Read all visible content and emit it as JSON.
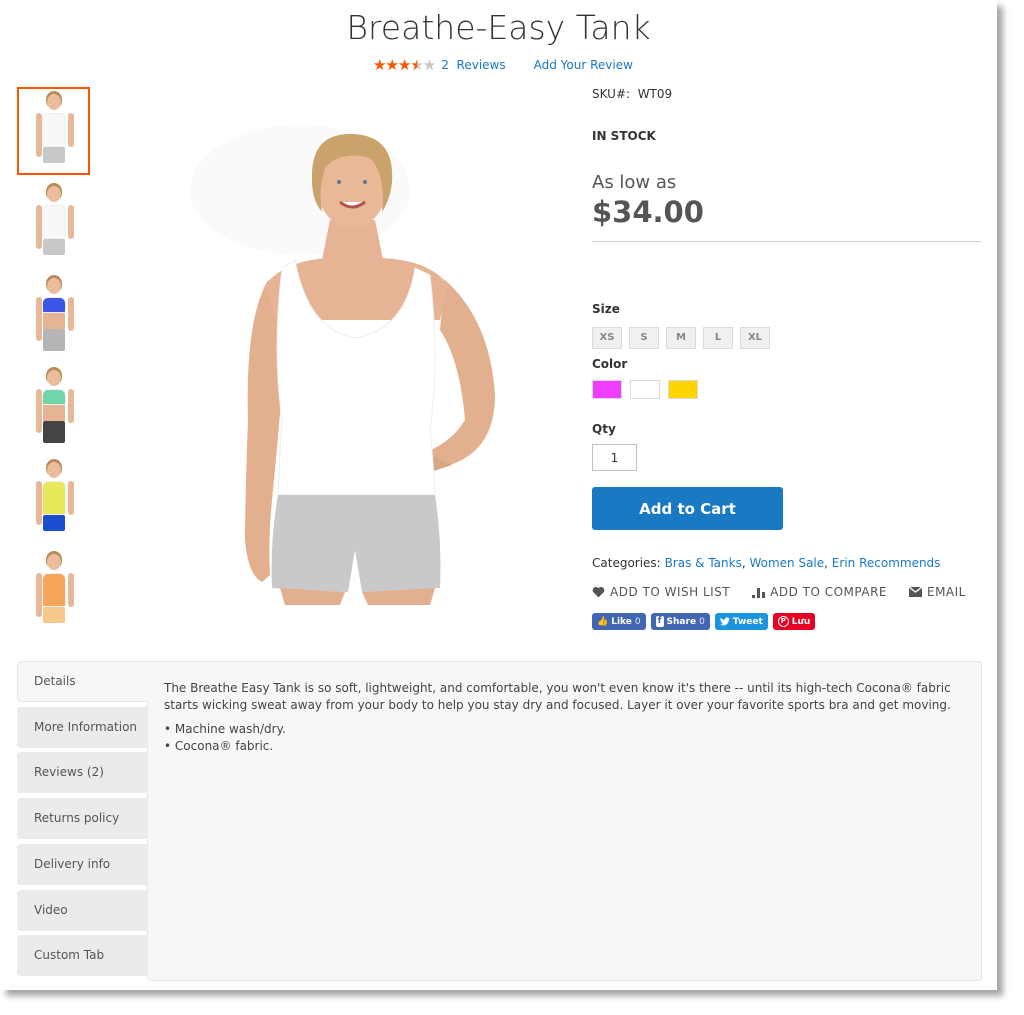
{
  "product": {
    "title": "Breathe-Easy Tank",
    "rating_percent": 70,
    "stars_glyph": "★★★★★",
    "reviews_count": "2",
    "reviews_label": "Reviews",
    "add_review_label": "Add Your Review",
    "sku_label": "SKU#:",
    "sku_value": "WT09",
    "stock_status": "IN STOCK",
    "price_prefix": "As low as",
    "price": "$34.00"
  },
  "gallery": {
    "active_index": 0,
    "thumbnails": [
      {
        "name": "white-tank-front",
        "top": "#f8f8f8",
        "bottom": "#c8c8c8"
      },
      {
        "name": "white-tank-back",
        "top": "#f8f8f8",
        "bottom": "#c8c8c8"
      },
      {
        "name": "blue-bra",
        "top": "#3b55e6",
        "bottom": "#b5b5b5"
      },
      {
        "name": "mint-bra",
        "top": "#6fd6ac",
        "bottom": "#444444"
      },
      {
        "name": "yellow-tee",
        "top": "#e8e85a",
        "bottom": "#1a4fd0"
      },
      {
        "name": "orange-tank",
        "top": "#f6a55a",
        "bottom": "#f6c98a"
      }
    ]
  },
  "options": {
    "size_label": "Size",
    "sizes": [
      "XS",
      "S",
      "M",
      "L",
      "XL"
    ],
    "color_label": "Color",
    "colors": [
      "#ef3dff",
      "#ffffff",
      "#ffd500"
    ],
    "qty_label": "Qty",
    "qty_value": "1"
  },
  "add_to_cart_label": "Add to Cart",
  "categories": {
    "label": "Categories:",
    "items": [
      "Bras & Tanks",
      "Women Sale",
      "Erin Recommends"
    ]
  },
  "actions": {
    "wishlist": "ADD TO WISH LIST",
    "compare": "ADD TO COMPARE",
    "email": "EMAIL"
  },
  "social": {
    "like": {
      "label": "Like",
      "count": "0",
      "color": "#4267b2"
    },
    "share": {
      "label": "Share",
      "count": "0",
      "color": "#4267b2"
    },
    "tweet": {
      "label": "Tweet",
      "color": "#1b95e0"
    },
    "pin": {
      "label": "Lưu",
      "color": "#e60023"
    }
  },
  "tabs": {
    "items": [
      "Details",
      "More Information",
      "Reviews (2)",
      "Returns policy",
      "Delivery info",
      "Video",
      "Custom Tab"
    ],
    "active": 0,
    "details": {
      "paragraph": "The Breathe Easy Tank is so soft, lightweight, and comfortable, you won't even know it's there -- until its high-tech Cocona® fabric starts wicking sweat away from your body to help you stay dry and focused. Layer it over your favorite sports bra and get moving.",
      "bullets": [
        "Machine wash/dry.",
        "Cocona® fabric."
      ]
    }
  }
}
